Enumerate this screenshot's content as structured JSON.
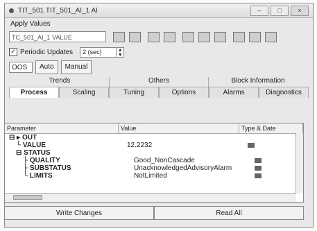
{
  "window": {
    "title": "TIT_501 TIT_501_AI_1 AI"
  },
  "menu": {
    "label": "Apply Values"
  },
  "tag": {
    "value": "TC_501_AI_1 VALUE"
  },
  "periodic": {
    "label": "Periodic Updates",
    "rate": "2 (sec)",
    "checked": "✓"
  },
  "mode": {
    "value": "OOS",
    "auto": "Auto",
    "manual": "Manual"
  },
  "tabs_top": [
    "Trends",
    "Others",
    "Block Information"
  ],
  "tabs": [
    "Process",
    "Scaling",
    "Tuning",
    "Options",
    "Alarms",
    "Diagnostics"
  ],
  "active_tab": "Process",
  "grid": {
    "headers": [
      "Parameter",
      "Value",
      "Type & Date"
    ],
    "rows": [
      {
        "param": "OUT",
        "value": ""
      },
      {
        "param": "VALUE",
        "value": "12.2232"
      },
      {
        "param": "STATUS",
        "value": ""
      },
      {
        "param": "QUALITY",
        "value": "Good_NonCascade"
      },
      {
        "param": "SUBSTATUS",
        "value": "UnacknowledgedAdvisoryAlarm"
      },
      {
        "param": "LIMITS",
        "value": "NotLimited"
      }
    ]
  },
  "buttons": {
    "write": "Write Changes",
    "read": "Read All"
  }
}
